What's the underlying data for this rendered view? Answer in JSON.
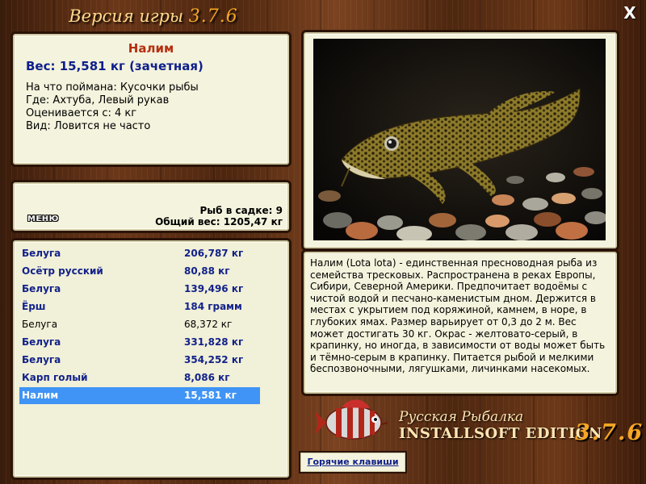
{
  "header": {
    "title": "Версия игры",
    "version": "3.7.6",
    "close_label": "X"
  },
  "fish_info": {
    "name": "Налим",
    "weight": "Вес: 15,581 кг (зачетная)",
    "caught_on": "На что поймана: Кусочки рыбы",
    "location": "Где: Ахтуба, Левый рукав",
    "valued_from": "Оценивается с: 4 кг",
    "kind": "Вид: Ловится не часто"
  },
  "keepnet": {
    "menu_label": "МЕНЮ",
    "count": "Рыб в садке: 9",
    "total_weight": "Общий вес: 1205,47 кг"
  },
  "catch_list": [
    {
      "name": "Белуга",
      "weight": "206,787 кг",
      "style": "bold"
    },
    {
      "name": "Осётр русский",
      "weight": "80,88 кг",
      "style": "bold"
    },
    {
      "name": "Белуга",
      "weight": "139,496 кг",
      "style": "bold"
    },
    {
      "name": "Ёрш",
      "weight": "184 грамм",
      "style": "bold"
    },
    {
      "name": "Белуга",
      "weight": "68,372 кг",
      "style": "plain"
    },
    {
      "name": "Белуга",
      "weight": "331,828 кг",
      "style": "bold"
    },
    {
      "name": "Белуга",
      "weight": "354,252 кг",
      "style": "bold"
    },
    {
      "name": "Карп голый",
      "weight": "8,086 кг",
      "style": "bold"
    },
    {
      "name": "Налим",
      "weight": "15,581 кг",
      "style": "selected"
    }
  ],
  "description": "Налим (Lota lota) - единственная пресноводная рыба из семейства тресковых. Распространена в реках Европы, Сибири, Северной Америки. Предпочитает водоёмы с чистой водой и песчано-каменистым дном. Держится в местах с укрытием под коряжиной, камнем, в норе, в глубоких ямах. Размер варьирует от 0,3 до 2 м. Вес может достигать 30 кг. Окрас - желтовато-серый, в крапинку, но иногда, в зависимости от воды может быть и тёмно-серым в крапинку. Питается рыбой и мелкими беспозвоночными, лягушками, личинками насекомых.",
  "branding": {
    "game_name": "Русская Рыбалка",
    "edition": "INSTALLSOFT EDITION",
    "version": "3.7.6"
  },
  "hotkeys_label": "Горячие клавиши",
  "icons": {
    "close": "close-icon",
    "logo": "perch-logo-icon",
    "photo": "burbot-photo"
  },
  "colors": {
    "panel_bg": "#f4f3dd",
    "fish_name": "#b52f10",
    "accent_text": "#12228a",
    "selection": "#3f94f5",
    "version_orange": "#f5a623"
  }
}
